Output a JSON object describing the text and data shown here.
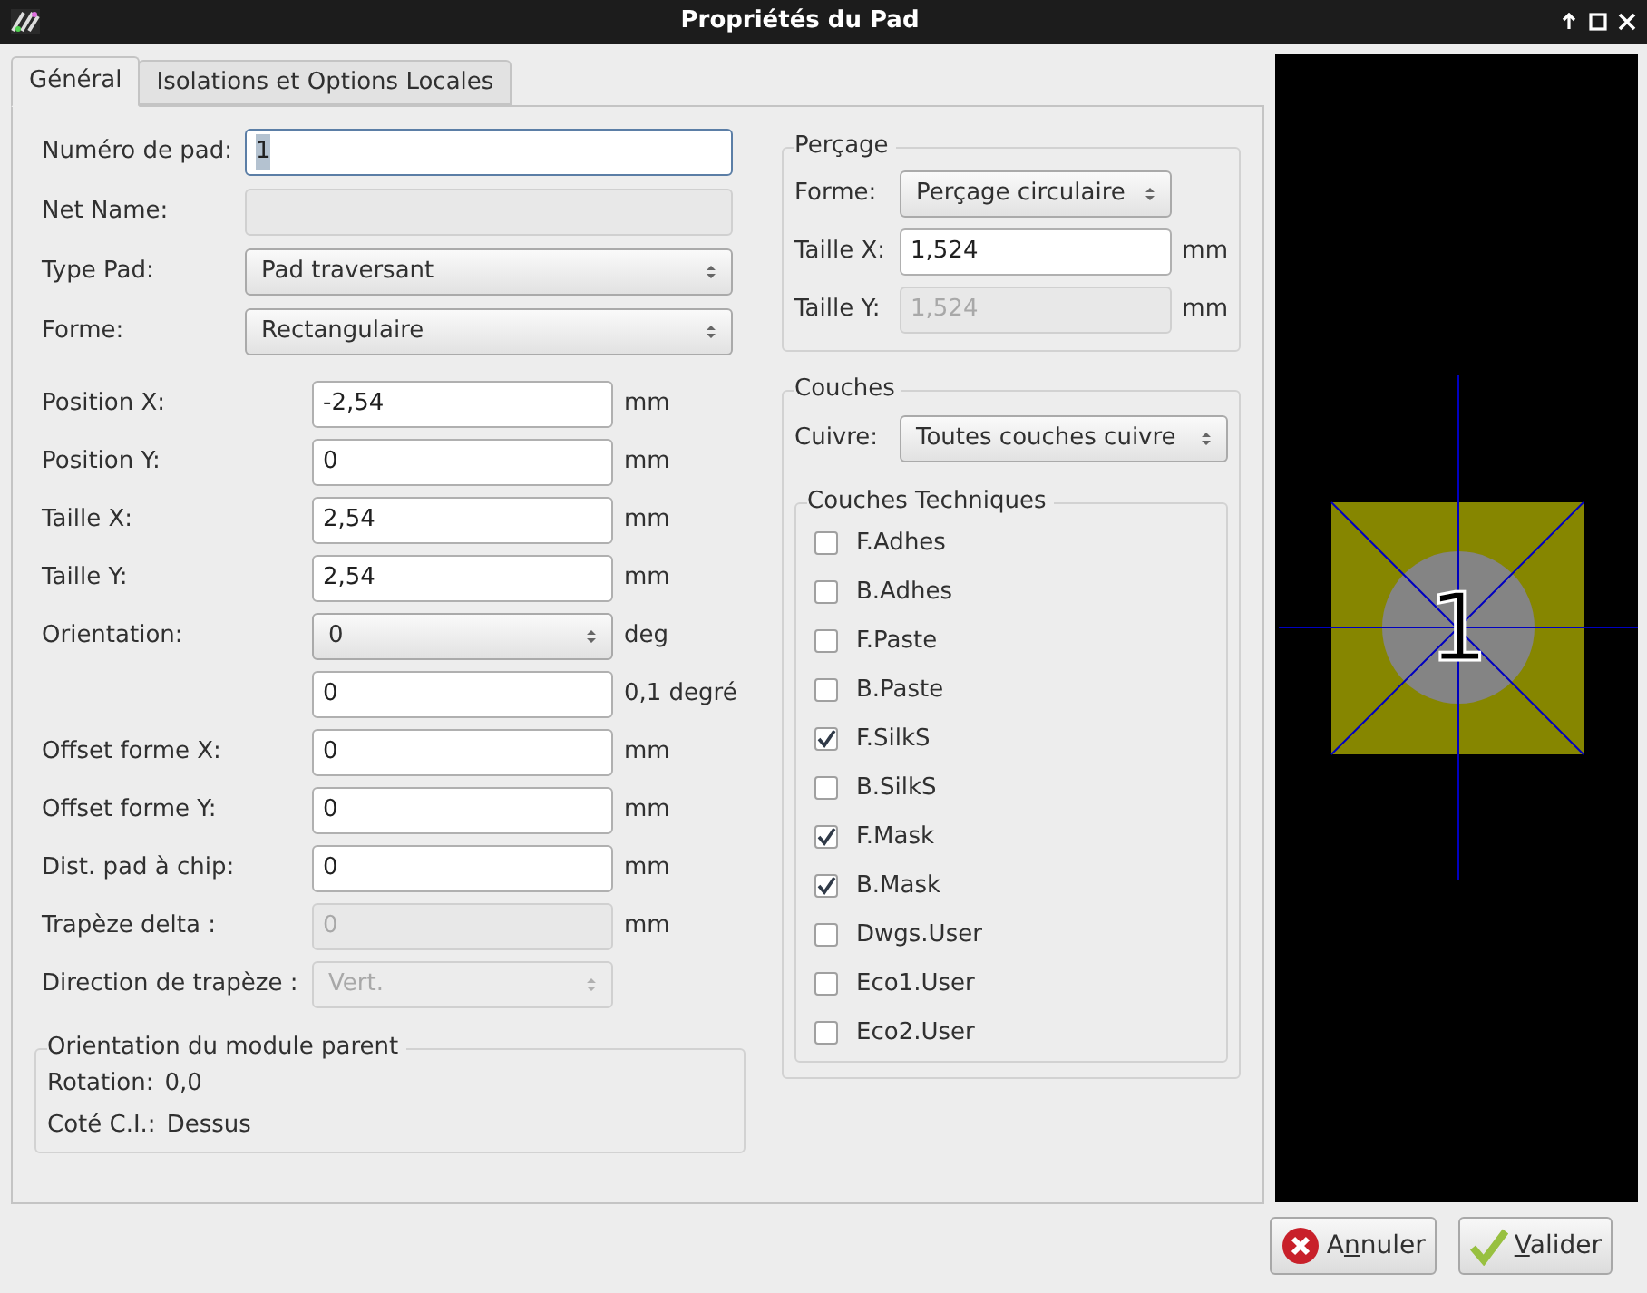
{
  "window": {
    "title": "Propriétés du Pad"
  },
  "tabs": [
    {
      "label": "Général",
      "selected": true
    },
    {
      "label": "Isolations et Options Locales",
      "selected": false
    }
  ],
  "pad_fields": [
    {
      "label": "Numéro de pad:",
      "kind": "text",
      "value": "1",
      "disabled": false,
      "focused": true
    },
    {
      "label": "Net Name:",
      "kind": "text",
      "disabled": true,
      "focused": false
    },
    {
      "label": "Type Pad:",
      "kind": "select",
      "value": "Pad traversant",
      "disabled": false,
      "focused": false
    },
    {
      "label": "Forme:",
      "kind": "select",
      "value": "Rectangulaire",
      "disabled": false,
      "focused": false
    }
  ],
  "geometry": [
    {
      "label": "Position X:",
      "kind": "text",
      "value": "-2,54",
      "unit": "mm",
      "disabled": false
    },
    {
      "label": "Position Y:",
      "kind": "text",
      "value": "0",
      "unit": "mm",
      "disabled": false
    },
    {
      "label": "Taille X:",
      "kind": "text",
      "value": "2,54",
      "unit": "mm",
      "disabled": false
    },
    {
      "label": "Taille Y:",
      "kind": "text",
      "value": "2,54",
      "unit": "mm",
      "disabled": false
    },
    {
      "label": "Orientation:",
      "kind": "select",
      "value": "0",
      "unit": "deg",
      "disabled": false
    },
    {
      "kind": "text",
      "value": "0",
      "unit": "0,1 degré",
      "disabled": false
    },
    {
      "label": "Offset forme X:",
      "kind": "text",
      "value": "0",
      "unit": "mm",
      "disabled": false
    },
    {
      "label": "Offset forme Y:",
      "kind": "text",
      "value": "0",
      "unit": "mm",
      "disabled": false
    },
    {
      "label": "Dist. pad à chip:",
      "kind": "text",
      "value": "0",
      "unit": "mm",
      "disabled": false
    },
    {
      "label": "Trapèze delta :",
      "kind": "text",
      "value": "0",
      "unit": "mm",
      "disabled": true
    },
    {
      "label": "Direction de trapèze :",
      "kind": "select",
      "value": "Vert.",
      "disabled": true
    }
  ],
  "parent_orientation": {
    "title": "Orientation du module parent",
    "rows": [
      {
        "label": "Rotation:",
        "value": "0,0"
      },
      {
        "label": "Coté C.I.:",
        "value": "Dessus"
      }
    ]
  },
  "drill": {
    "title": "Perçage",
    "fields": [
      {
        "label": "Forme:",
        "kind": "select",
        "value": "Perçage circulaire",
        "disabled": false
      },
      {
        "label": "Taille X:",
        "kind": "text",
        "value": "1,524",
        "unit": "mm",
        "disabled": false
      },
      {
        "label": "Taille Y:",
        "kind": "text",
        "value": "1,524",
        "unit": "mm",
        "disabled": true
      }
    ]
  },
  "layers": {
    "title": "Couches",
    "copper": {
      "label": "Cuivre:",
      "value": "Toutes couches cuivre"
    },
    "technical": {
      "title": "Couches Techniques",
      "items": [
        {
          "label": "F.Adhes",
          "checked": false
        },
        {
          "label": "B.Adhes",
          "checked": false
        },
        {
          "label": "F.Paste",
          "checked": false
        },
        {
          "label": "B.Paste",
          "checked": false
        },
        {
          "label": "F.SilkS",
          "checked": true
        },
        {
          "label": "B.SilkS",
          "checked": false
        },
        {
          "label": "F.Mask",
          "checked": true
        },
        {
          "label": "B.Mask",
          "checked": true
        },
        {
          "label": "Dwgs.User",
          "checked": false
        },
        {
          "label": "Eco1.User",
          "checked": false
        },
        {
          "label": "Eco2.User",
          "checked": false
        }
      ]
    }
  },
  "preview": {
    "pad_label": "1"
  },
  "buttons": [
    {
      "kind": "cancel",
      "lead": "A",
      "mnemonic": "n",
      "rest": "nuler"
    },
    {
      "kind": "ok",
      "mnemonic": "V",
      "rest": "alider"
    }
  ]
}
